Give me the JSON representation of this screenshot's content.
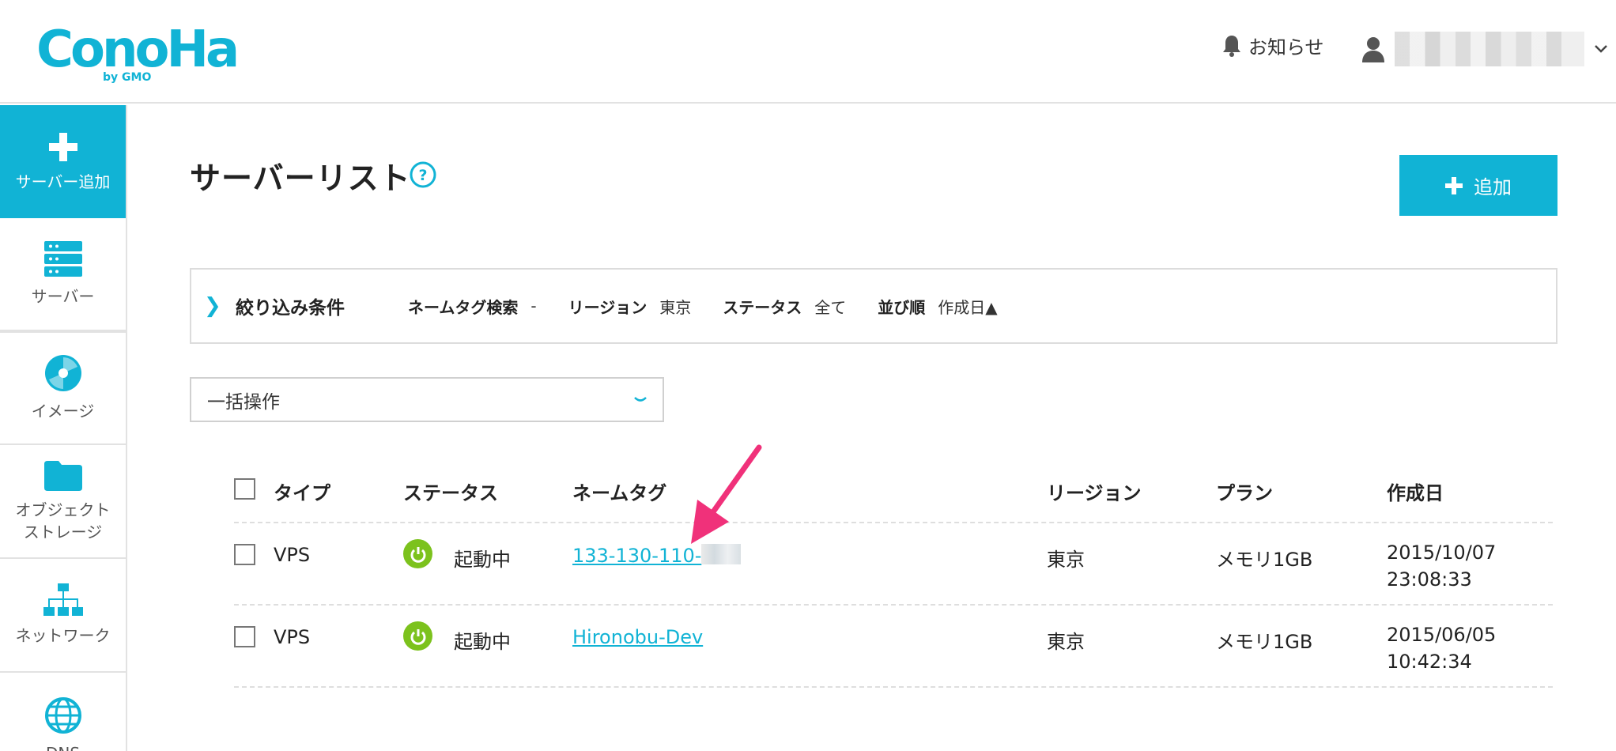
{
  "brand": {
    "name": "ConoHa",
    "by": "by GMO",
    "color": "#11b3d5"
  },
  "header": {
    "notice_label": "お知らせ",
    "user_name": ""
  },
  "sidebar": {
    "items": [
      {
        "label": "サーバー追加",
        "icon": "plus-icon",
        "active": true
      },
      {
        "label": "サーバー",
        "icon": "server-icon"
      },
      {
        "label": "イメージ",
        "icon": "disc-icon"
      },
      {
        "label": "オブジェクト\nストレージ",
        "icon": "folder-icon"
      },
      {
        "label": "ネットワーク",
        "icon": "network-icon"
      },
      {
        "label": "DNS",
        "icon": "globe-icon"
      }
    ]
  },
  "main": {
    "title": "サーバーリスト",
    "add_button": "追加",
    "filter": {
      "title": "絞り込み条件",
      "nametag_label": "ネームタグ検索",
      "nametag_value": "-",
      "region_label": "リージョン",
      "region_value": "東京",
      "status_label": "ステータス",
      "status_value": "全て",
      "sort_label": "並び順",
      "sort_value": "作成日▲"
    },
    "bulk_select": {
      "selected": "一括操作"
    },
    "table": {
      "columns": [
        "タイプ",
        "ステータス",
        "ネームタグ",
        "リージョン",
        "プラン",
        "作成日"
      ],
      "rows": [
        {
          "type": "VPS",
          "status": "起動中",
          "nametag": "133-130-110-",
          "region": "東京",
          "plan": "メモリ1GB",
          "date": "2015/10/07",
          "time": "23:08:33"
        },
        {
          "type": "VPS",
          "status": "起動中",
          "nametag": "Hironobu-Dev",
          "region": "東京",
          "plan": "メモリ1GB",
          "date": "2015/06/05",
          "time": "10:42:34"
        }
      ]
    }
  },
  "colors": {
    "accent": "#11b3d5",
    "status_running": "#7cc21d",
    "annotation": "#f0317a"
  }
}
